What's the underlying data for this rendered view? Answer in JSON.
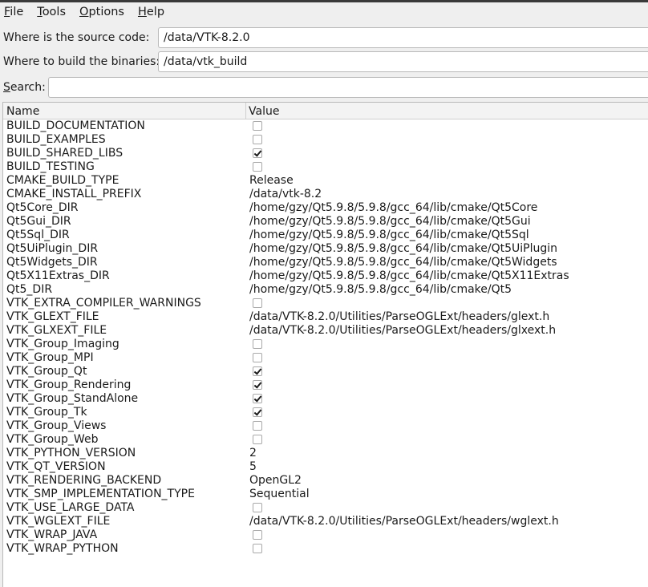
{
  "menu": [
    {
      "mnemonic": "F",
      "rest": "ile"
    },
    {
      "mnemonic": "T",
      "rest": "ools"
    },
    {
      "mnemonic": "O",
      "rest": "ptions"
    },
    {
      "mnemonic": "H",
      "rest": "elp"
    }
  ],
  "source": {
    "label": "Where is the source code:",
    "value": "/data/VTK-8.2.0"
  },
  "build": {
    "label": "Where to build the binaries:",
    "value": "/data/vtk_build"
  },
  "search": {
    "label_mnemonic": "S",
    "label_rest": "earch:",
    "value": ""
  },
  "table": {
    "headers": {
      "name": "Name",
      "value": "Value"
    },
    "rows": [
      {
        "name": "BUILD_DOCUMENTATION",
        "type": "bool",
        "checked": false
      },
      {
        "name": "BUILD_EXAMPLES",
        "type": "bool",
        "checked": false
      },
      {
        "name": "BUILD_SHARED_LIBS",
        "type": "bool",
        "checked": true
      },
      {
        "name": "BUILD_TESTING",
        "type": "bool",
        "checked": false
      },
      {
        "name": "CMAKE_BUILD_TYPE",
        "type": "text",
        "value": "Release"
      },
      {
        "name": "CMAKE_INSTALL_PREFIX",
        "type": "text",
        "value": "/data/vtk-8.2"
      },
      {
        "name": "Qt5Core_DIR",
        "type": "text",
        "value": "/home/gzy/Qt5.9.8/5.9.8/gcc_64/lib/cmake/Qt5Core"
      },
      {
        "name": "Qt5Gui_DIR",
        "type": "text",
        "value": "/home/gzy/Qt5.9.8/5.9.8/gcc_64/lib/cmake/Qt5Gui"
      },
      {
        "name": "Qt5Sql_DIR",
        "type": "text",
        "value": "/home/gzy/Qt5.9.8/5.9.8/gcc_64/lib/cmake/Qt5Sql"
      },
      {
        "name": "Qt5UiPlugin_DIR",
        "type": "text",
        "value": "/home/gzy/Qt5.9.8/5.9.8/gcc_64/lib/cmake/Qt5UiPlugin"
      },
      {
        "name": "Qt5Widgets_DIR",
        "type": "text",
        "value": "/home/gzy/Qt5.9.8/5.9.8/gcc_64/lib/cmake/Qt5Widgets"
      },
      {
        "name": "Qt5X11Extras_DIR",
        "type": "text",
        "value": "/home/gzy/Qt5.9.8/5.9.8/gcc_64/lib/cmake/Qt5X11Extras"
      },
      {
        "name": "Qt5_DIR",
        "type": "text",
        "value": "/home/gzy/Qt5.9.8/5.9.8/gcc_64/lib/cmake/Qt5"
      },
      {
        "name": "VTK_EXTRA_COMPILER_WARNINGS",
        "type": "bool",
        "checked": false
      },
      {
        "name": "VTK_GLEXT_FILE",
        "type": "text",
        "value": "/data/VTK-8.2.0/Utilities/ParseOGLExt/headers/glext.h"
      },
      {
        "name": "VTK_GLXEXT_FILE",
        "type": "text",
        "value": "/data/VTK-8.2.0/Utilities/ParseOGLExt/headers/glxext.h"
      },
      {
        "name": "VTK_Group_Imaging",
        "type": "bool",
        "checked": false
      },
      {
        "name": "VTK_Group_MPI",
        "type": "bool",
        "checked": false
      },
      {
        "name": "VTK_Group_Qt",
        "type": "bool",
        "checked": true
      },
      {
        "name": "VTK_Group_Rendering",
        "type": "bool",
        "checked": true
      },
      {
        "name": "VTK_Group_StandAlone",
        "type": "bool",
        "checked": true
      },
      {
        "name": "VTK_Group_Tk",
        "type": "bool",
        "checked": true
      },
      {
        "name": "VTK_Group_Views",
        "type": "bool",
        "checked": false
      },
      {
        "name": "VTK_Group_Web",
        "type": "bool",
        "checked": false
      },
      {
        "name": "VTK_PYTHON_VERSION",
        "type": "text",
        "value": "2"
      },
      {
        "name": "VTK_QT_VERSION",
        "type": "text",
        "value": "5"
      },
      {
        "name": "VTK_RENDERING_BACKEND",
        "type": "text",
        "value": "OpenGL2"
      },
      {
        "name": "VTK_SMP_IMPLEMENTATION_TYPE",
        "type": "text",
        "value": "Sequential"
      },
      {
        "name": "VTK_USE_LARGE_DATA",
        "type": "bool",
        "checked": false
      },
      {
        "name": "VTK_WGLEXT_FILE",
        "type": "text",
        "value": "/data/VTK-8.2.0/Utilities/ParseOGLExt/headers/wglext.h"
      },
      {
        "name": "VTK_WRAP_JAVA",
        "type": "bool",
        "checked": false
      },
      {
        "name": "VTK_WRAP_PYTHON",
        "type": "bool",
        "checked": false
      }
    ]
  }
}
